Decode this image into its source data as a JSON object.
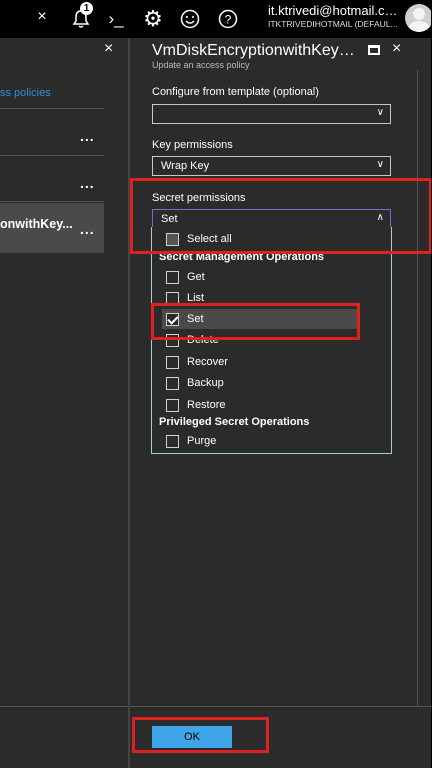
{
  "topbar": {
    "close_label": "×",
    "notification_count": "1",
    "cloud_shell_label": "›_",
    "settings_label": "⚙",
    "feedback_label": "☺",
    "help_label": "?",
    "user_email": "it.ktrivedi@hotmail.co...",
    "user_directory": "ITKTRIVEDIHOTMAIL (DEFAUL..."
  },
  "left_blade": {
    "close_label": "×",
    "link_text": "ss policies",
    "items": [
      {
        "label": "",
        "more": "..."
      },
      {
        "label": "",
        "more": "..."
      },
      {
        "label": "onwithKey...",
        "more": "..."
      }
    ]
  },
  "blade": {
    "title": "VmDiskEncryptionwithKeyVa...",
    "subtitle": "Update an access policy",
    "close_label": "×"
  },
  "form": {
    "template_label": "Configure from template (optional)",
    "template_value": "",
    "key_permissions_label": "Key permissions",
    "key_permissions_value": "Wrap Key",
    "secret_permissions_label": "Secret permissions",
    "secret_permissions_value": "Set",
    "chevron_down": "∨",
    "chevron_up": "∧"
  },
  "secret_list": {
    "select_all": "Select all",
    "groups": [
      {
        "heading": "Secret Management Operations",
        "options": [
          {
            "label": "Get",
            "checked": false
          },
          {
            "label": "List",
            "checked": false
          },
          {
            "label": "Set",
            "checked": true
          },
          {
            "label": "Delete",
            "checked": false
          },
          {
            "label": "Recover",
            "checked": false
          },
          {
            "label": "Backup",
            "checked": false
          },
          {
            "label": "Restore",
            "checked": false
          }
        ]
      },
      {
        "heading": "Privileged Secret Operations",
        "options": [
          {
            "label": "Purge",
            "checked": false
          }
        ]
      }
    ]
  },
  "footer": {
    "ok_label": "OK"
  },
  "colors": {
    "background": "#2b2b2b",
    "topbar": "#000000",
    "accent": "#3ea6e8",
    "link": "#2f8fd6",
    "annotation": "#e01f1f"
  }
}
